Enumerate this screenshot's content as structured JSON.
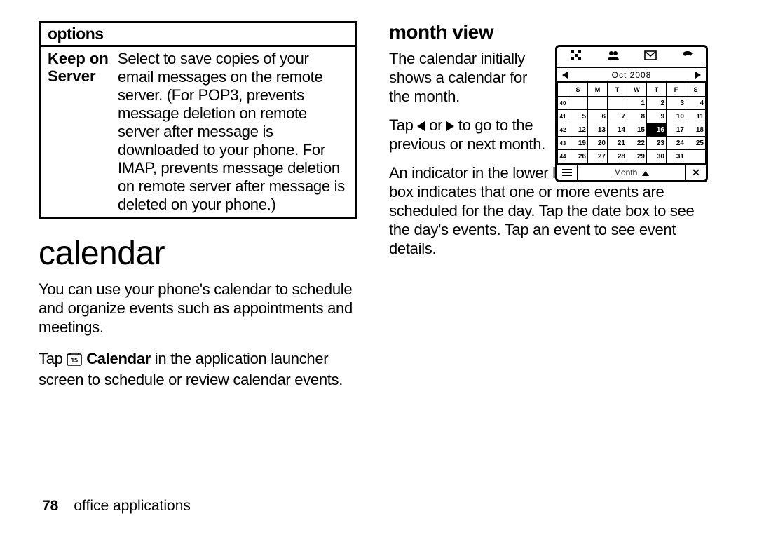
{
  "options": {
    "header": "options",
    "row1_label_l1": "Keep on",
    "row1_label_l2": "Server",
    "row1_desc": "Select to save copies of your email messages on the remote server. (For POP3, prevents message deletion on remote server after message is downloaded to your phone. For IMAP, prevents message deletion on remote server after message is deleted on your phone.)"
  },
  "calendar": {
    "title": "calendar",
    "p1": "You can use your phone's calendar to schedule and organize events such as appointments and meetings.",
    "p2_a": "Tap ",
    "p2_b": " Calendar",
    "p2_c": " in the application launcher screen to schedule or review calendar events."
  },
  "month": {
    "title": "month view",
    "p1": "The calendar initially shows a calendar for the month.",
    "p2_a": "Tap ",
    "p2_b": " or ",
    "p2_c": " to go to the previous or next month.",
    "p3": "An indicator in the lower left corner of the date box indicates that one or more events are scheduled for the day. Tap the date box to see the day's events. Tap an event to see event details."
  },
  "mini_cal": {
    "nav_label": "Oct  2008",
    "days": [
      "S",
      "M",
      "T",
      "W",
      "T",
      "F",
      "S"
    ],
    "weeks": [
      {
        "wk": "40",
        "d": [
          "",
          "",
          "",
          "1",
          "2",
          "3",
          "4"
        ]
      },
      {
        "wk": "41",
        "d": [
          "5",
          "6",
          "7",
          "8",
          "9",
          "10",
          "11"
        ]
      },
      {
        "wk": "42",
        "d": [
          "12",
          "13",
          "14",
          "15",
          "16",
          "17",
          "18"
        ],
        "hl": 4
      },
      {
        "wk": "43",
        "d": [
          "19",
          "20",
          "21",
          "22",
          "23",
          "24",
          "25"
        ]
      },
      {
        "wk": "44",
        "d": [
          "26",
          "27",
          "28",
          "29",
          "30",
          "31",
          ""
        ]
      }
    ],
    "bottom_label": "Month",
    "close": "✕"
  },
  "footer": {
    "page": "78",
    "section": "office applications"
  }
}
